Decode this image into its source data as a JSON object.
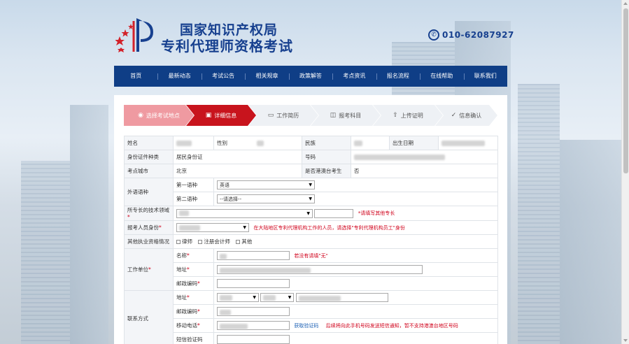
{
  "header": {
    "title_line1": "国家知识产权局",
    "title_line2": "专利代理师资格考试",
    "phone_icon": "phone-icon",
    "phone": "010-62087927"
  },
  "nav": [
    "首页",
    "最新动态",
    "考试公告",
    "相关规章",
    "政策解答",
    "考点资讯",
    "报名流程",
    "在线帮助",
    "联系我们"
  ],
  "steps": [
    {
      "label": "选择考试地点",
      "icon": "location-icon",
      "state": "done"
    },
    {
      "label": "详细信息",
      "icon": "clipboard-icon",
      "state": "active"
    },
    {
      "label": "工作简历",
      "icon": "folder-icon",
      "state": "todo"
    },
    {
      "label": "报考科目",
      "icon": "book-icon",
      "state": "todo"
    },
    {
      "label": "上传证明",
      "icon": "upload-icon",
      "state": "todo"
    },
    {
      "label": "信息确认",
      "icon": "check-circle-icon",
      "state": "todo"
    }
  ],
  "form": {
    "name_label": "姓名",
    "gender_label": "性别",
    "ethnicity_label": "民族",
    "birthdate_label": "出生日期",
    "id_type_label": "身份证件种类",
    "id_type_value": "居民身份证",
    "id_number_label": "号码",
    "exam_city_label": "考点城市",
    "exam_city_value": "北京",
    "hk_macau_tw_label": "是否港澳台考生",
    "hk_macau_tw_value": "否",
    "foreign_lang_label": "外语语种",
    "first_lang_label": "第一语种",
    "first_lang_value": "英语",
    "second_lang_label": "第二语种",
    "second_lang_value": "--请选择--",
    "tech_field_label": "所专长的技术领域",
    "tech_field_hint": "*请填写其他专长",
    "applicant_identity_label": "报考人员身份",
    "applicant_identity_hint": "在大陆地区专利代理机构工作的人员，请选择\"专利代理机构员工\"身份",
    "other_qual_label": "其他执业资格情况",
    "other_qual_options": [
      "律师",
      "注册会计师",
      "其他"
    ],
    "work_unit_label": "工作单位",
    "unit_name_label": "名称",
    "unit_name_hint": "若没有请填\"无\"",
    "unit_address_label": "地址",
    "unit_postcode_label": "邮政编码",
    "contact_label": "联系方式",
    "contact_address_label": "地址",
    "contact_postcode_label": "邮政编码",
    "mobile_label": "移动电话",
    "get_code_link": "获取验证码",
    "mobile_hint": "后续将向此手机号码发送短信通知，暂不支持港澳台地区号码",
    "sms_code_label": "短信验证码",
    "required_mark": "*"
  }
}
